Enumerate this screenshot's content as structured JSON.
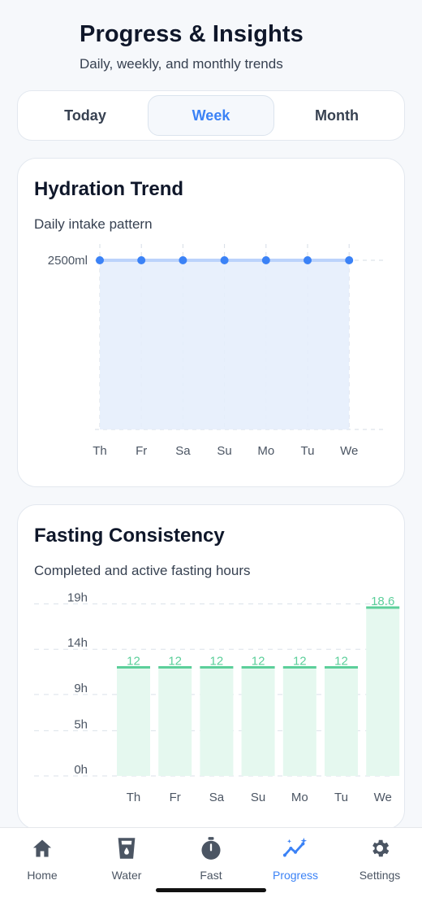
{
  "header": {
    "title": "Progress & Insights",
    "subtitle": "Daily, weekly, and monthly trends"
  },
  "segments": [
    {
      "label": "Today",
      "active": false
    },
    {
      "label": "Week",
      "active": true
    },
    {
      "label": "Month",
      "active": false
    }
  ],
  "hydration": {
    "title": "Hydration Trend",
    "subtitle": "Daily intake pattern"
  },
  "fasting": {
    "title": "Fasting Consistency",
    "subtitle": "Completed and active fasting hours"
  },
  "chart_data": [
    {
      "type": "area",
      "x": [
        "Th",
        "Fr",
        "Sa",
        "Su",
        "Mo",
        "Tu",
        "We"
      ],
      "values": [
        2500,
        2500,
        2500,
        2500,
        2500,
        2500,
        2500
      ],
      "y_tick_labels": [
        "2500ml"
      ],
      "ylim": [
        0,
        2500
      ],
      "grid": true,
      "color": "#3b82f6",
      "fill": "#e6eefc"
    },
    {
      "type": "bar",
      "categories": [
        "Th",
        "Fr",
        "Sa",
        "Su",
        "Mo",
        "Tu",
        "We"
      ],
      "values": [
        12,
        12,
        12,
        12,
        12,
        12,
        18.6
      ],
      "data_labels": [
        "12",
        "12",
        "12",
        "12",
        "12",
        "12",
        "18.6"
      ],
      "y_ticks": [
        0,
        5,
        9,
        14,
        19
      ],
      "y_tick_labels": [
        "0h",
        "5h",
        "9h",
        "14h",
        "19h"
      ],
      "ylim": [
        0,
        18.6
      ],
      "grid": true,
      "color": "#5ccf9a",
      "fill": "#e5f8ef"
    }
  ],
  "tabbar": [
    {
      "label": "Home",
      "icon": "home-icon",
      "active": false
    },
    {
      "label": "Water",
      "icon": "water-glass-icon",
      "active": false
    },
    {
      "label": "Fast",
      "icon": "stopwatch-icon",
      "active": false
    },
    {
      "label": "Progress",
      "icon": "trend-sparkle-icon",
      "active": true
    },
    {
      "label": "Settings",
      "icon": "gear-icon",
      "active": false
    }
  ],
  "colors": {
    "accent": "#3b82f6",
    "text_dark": "#0f172a",
    "muted": "#4b5563",
    "fasting_green": "#5ccf9a"
  }
}
